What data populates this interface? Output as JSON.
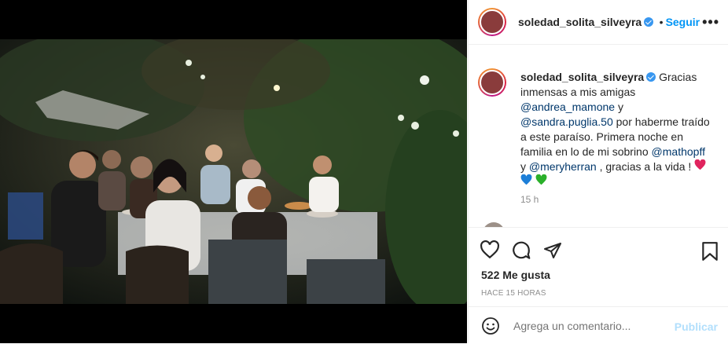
{
  "post": {
    "username": "soledad_solita_silveyra",
    "follow_label": "Seguir",
    "separator": "•",
    "caption_parts": [
      {
        "text": "Gracias inmensas a mis amigas ",
        "type": "text"
      },
      {
        "text": "@andrea_mamone",
        "type": "mention"
      },
      {
        "text": " y ",
        "type": "text"
      },
      {
        "text": "@sandra.puglia.50",
        "type": "mention"
      },
      {
        "text": " por haberme traído a este paraíso. Primera noche en familia en lo de mi sobrino ",
        "type": "text"
      },
      {
        "text": "@mathopff",
        "type": "mention"
      },
      {
        "text": " y ",
        "type": "text"
      },
      {
        "text": "@meryherran",
        "type": "mention"
      },
      {
        "text": " , gracias a la vida ! ",
        "type": "text"
      }
    ],
    "emojis": [
      "red-heart",
      "blue-heart",
      "green-heart"
    ],
    "comment_time": "15 h",
    "likes": "522 Me gusta",
    "posted_ago": "HACE 15 HORAS",
    "comment_placeholder": "Agrega un comentario...",
    "publish_label": "Publicar"
  },
  "colors": {
    "link": "#0095f6",
    "mention": "#00376b",
    "publish_disabled": "#b2dffc",
    "red_heart": "#e0245e",
    "blue_heart": "#1d7fd8",
    "green_heart": "#2bb02b"
  }
}
